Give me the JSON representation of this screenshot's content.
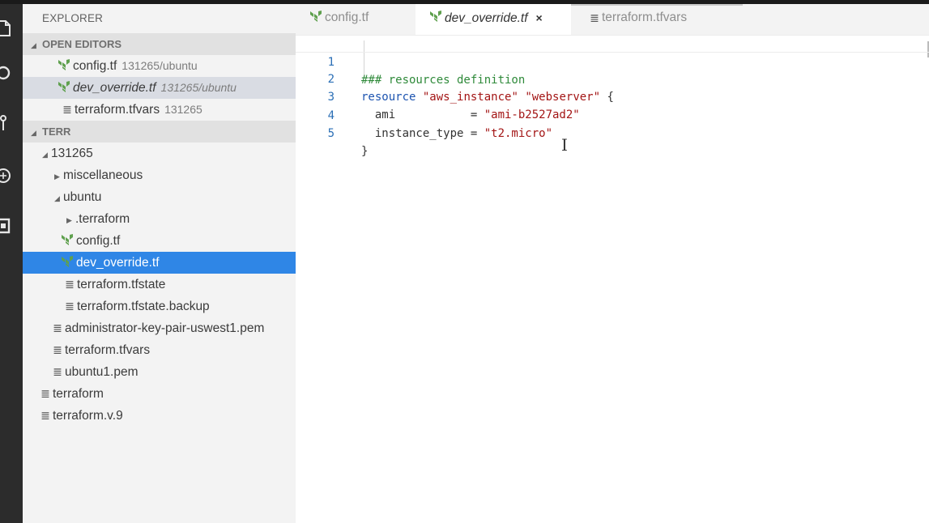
{
  "sidebar": {
    "title": "EXPLORER",
    "open_editors_header": "OPEN EDITORS",
    "open_editors": [
      {
        "name": "config.tf",
        "desc": "131265/ubuntu",
        "icon": "terraform-icon"
      },
      {
        "name": "dev_override.tf",
        "desc": "131265/ubuntu",
        "icon": "terraform-icon"
      },
      {
        "name": "terraform.tfvars",
        "desc": "131265",
        "icon": "lines-icon"
      }
    ],
    "folder_header": "TERR",
    "tree": {
      "f131265": "131265",
      "miscellaneous": "miscellaneous",
      "ubuntu": "ubuntu",
      "dot_terraform": ".terraform",
      "config_tf": "config.tf",
      "dev_override_tf": "dev_override.tf",
      "tfstate": "terraform.tfstate",
      "tfstate_backup": "terraform.tfstate.backup",
      "admin_pem": "administrator-key-pair-uswest1.pem",
      "tfvars": "terraform.tfvars",
      "ubuntu1_pem": "ubuntu1.pem",
      "terraform": "terraform",
      "terraform_v9": "terraform.v.9"
    }
  },
  "tabs": [
    {
      "label": "config.tf"
    },
    {
      "label": "dev_override.tf",
      "close": "×"
    },
    {
      "label": "terraform.tfvars"
    }
  ],
  "code": {
    "line_numbers": [
      "1",
      "2",
      "3",
      "4",
      "5"
    ],
    "l1": "### resources definition",
    "l2_kw": "resource",
    "l2_s1": "\"aws_instance\"",
    "l2_s2": "\"webserver\"",
    "l2_brace": "{",
    "l3_key": "  ami           = ",
    "l3_val": "\"ami-b2527ad2\"",
    "l4_key": "  instance_type = ",
    "l4_val": "\"t2.micro\"",
    "l5": "}"
  },
  "colors": {
    "selection": "#2f86e6",
    "terraform_icon": "#5fa04e",
    "comment": "#2f8a3a",
    "keyword": "#1d54b0",
    "string": "#a31515"
  }
}
